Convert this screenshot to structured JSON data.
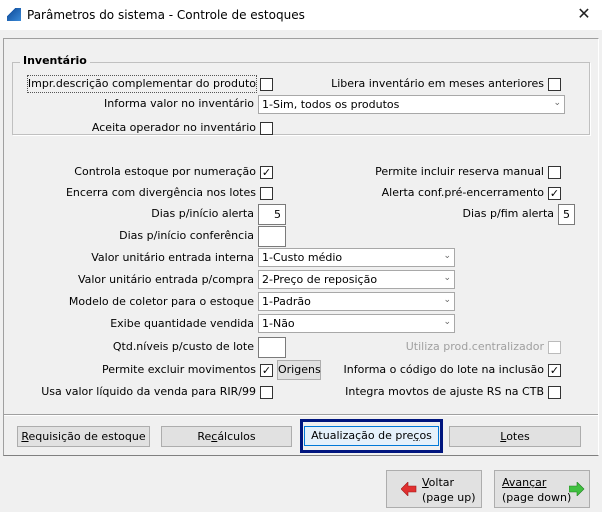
{
  "window": {
    "title": "Parâmetros do sistema - Controle de estoques",
    "close": "✕"
  },
  "inventario": {
    "legend": "Inventário",
    "impr_desc": {
      "label": "Impr.descrição complementar do produto",
      "checked": false
    },
    "libera": {
      "label": "Libera inventário em meses anteriores",
      "checked": false
    },
    "informa_valor": {
      "label": "Informa valor no inventário",
      "value": "1-Sim, todos os produtos"
    },
    "aceita_operador": {
      "label": "Aceita operador no inventário",
      "checked": false
    }
  },
  "fields": {
    "controla_numeracao": {
      "label": "Controla estoque por numeração",
      "checked": true,
      "mark": "✓"
    },
    "permite_reserva": {
      "label": "Permite incluir reserva manual",
      "checked": false
    },
    "encerra_divergencia": {
      "label": "Encerra com divergência nos lotes",
      "checked": false
    },
    "alerta_conf": {
      "label": "Alerta conf.pré-encerramento",
      "checked": true,
      "mark": "✓"
    },
    "dias_inicio_alerta": {
      "label": "Dias p/início alerta",
      "value": "5"
    },
    "dias_fim_alerta": {
      "label": "Dias p/fim alerta",
      "value": "5"
    },
    "dias_inicio_conf": {
      "label": "Dias p/início conferência",
      "value": ""
    },
    "valor_entrada_interna": {
      "label": "Valor unitário entrada interna",
      "value": "1-Custo médio"
    },
    "valor_entrada_compra": {
      "label": "Valor unitário entrada p/compra",
      "value": "2-Preço de reposição"
    },
    "modelo_coletor": {
      "label": "Modelo de coletor para o estoque",
      "value": "1-Padrão"
    },
    "exibe_qtd": {
      "label": "Exibe quantidade vendida",
      "value": "1-Não"
    },
    "qtd_niveis": {
      "label": "Qtd.níveis p/custo de lote",
      "value": ""
    },
    "utiliza_prod": {
      "label": "Utiliza prod.centralizador",
      "checked": false,
      "disabled": true
    },
    "permite_excluir": {
      "label": "Permite excluir movimentos",
      "checked": true,
      "mark": "✓"
    },
    "origens_button": "Origens",
    "informa_codigo_lote": {
      "label": "Informa o código do lote na inclusão",
      "checked": true,
      "mark": "✓"
    },
    "usa_valor_liquido": {
      "label": "Usa valor líquido da venda para RIR/99",
      "checked": false
    },
    "integra_movtos": {
      "label": "Integra movtos de ajuste RS na CTB",
      "checked": false
    }
  },
  "buttons": {
    "requisicao": {
      "pre": "",
      "key": "R",
      "post": "equisição de estoque"
    },
    "recalculos": {
      "pre": "Re",
      "key": "c",
      "post": "álculos"
    },
    "atualizacao": {
      "pre": "Atualização de pre",
      "key": "ç",
      "post": "os"
    },
    "lotes": {
      "pre": "",
      "key": "L",
      "post": "otes"
    }
  },
  "nav": {
    "voltar": {
      "key": "V",
      "post": "oltar",
      "sub": "(page up)"
    },
    "avancar": {
      "key": "A",
      "post": "vançar",
      "sub": "(page down)"
    }
  },
  "colors": {
    "focus": "#00157e",
    "back_arrow": "#e03030",
    "next_arrow": "#40c040"
  }
}
